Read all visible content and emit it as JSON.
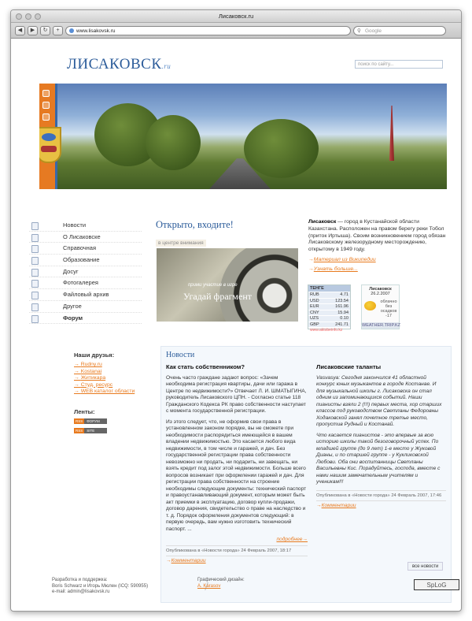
{
  "window": {
    "title": "Лисаковск.ru",
    "url": "www.lisakovsk.ru",
    "google": "Google"
  },
  "site": {
    "logo": "ЛИСАКОВСК",
    "logo_suffix": ".ru",
    "search_placeholder": "поиск по сайту..."
  },
  "nav": [
    "Новости",
    "О Лисаковске",
    "Справочная",
    "Образование",
    "Досуг",
    "Фотогалерея",
    "Файловый архив",
    "Другое",
    "Форум"
  ],
  "hero": {
    "title": "Открыто, входите!",
    "attention": "в центре внимания",
    "promo_small": "прими участие в игре",
    "promo_big": "Угадай фрагмент"
  },
  "about": {
    "city": "Лисаковск",
    "text": " — город в Кустанайской области Казахстана. Расположен на правом берегу реки Тобол (приток Иртыша). Своим возникновением город обязан Лисаковскому железорудному месторождению, открытому в 1949 году.",
    "wiki": "Материал из Википедии",
    "more": "Узнать больше..."
  },
  "informer": {
    "head": "ТЕНГЕ",
    "rows": [
      [
        "RUB",
        "4.71"
      ],
      [
        "USD",
        "123.54"
      ],
      [
        "EUR",
        "161.96"
      ],
      [
        "CNY",
        "15.94"
      ],
      [
        "UZS",
        "0.10"
      ],
      [
        "GBP",
        "241.71"
      ]
    ],
    "footer": "www.aktobeinfo.kz"
  },
  "weather": {
    "city": "Лисаковск",
    "date": "26.2.2007",
    "desc": "облачно без осадков -17",
    "footer": "WEATHER.TRIP.KZ"
  },
  "friends": {
    "title": "Наши друзья:",
    "items": [
      "Rudny.ru",
      "Kostanai",
      "Житикара",
      "Студ. ресурс",
      "WEB каталог области"
    ]
  },
  "lenty": {
    "title": "Ленты:",
    "items": [
      {
        "tag": "RSS",
        "name": "ФОРУМ"
      },
      {
        "tag": "RSS",
        "name": "SITE"
      }
    ]
  },
  "news": {
    "title": "Новости",
    "left": {
      "heading": "Как стать собственником?",
      "p1": "Очень часто граждане задают вопрос: «Зачем необходима регистрация квартиры, дачи или гаража в Центре по недвижимости?» Отвечает Л. И. ШМАТЫГИНА, руководитель Лисаковского ЦПН. - Согласно статье 118 Гражданского Кодекса РК право собственности наступает с момента государственной регистрации.",
      "p2": "Из этого следует, что, не оформив свои права в установленном законом порядке, вы не сможете при необходимости распорядиться имеющейся в вашем владении недвижимостью. Это касается любого вида недвижимости, в том числе и гаражей, и дач. Без государственной регистрации права собственности невозможно ни продать, ни подарить, ни завещать, ни взять кредит под залог этой недвижимости. Больше всего вопросов возникает при оформлении гаражей и дач. Для регистрации права собственности на строение необходимы следующие документы: технический паспорт и правоустанавливающий документ, которым может быть акт приемки в эксплуатацию, договор купли-продажи, договор дарения, свидетельство о праве на наследство и т. д. Порядок оформления документов следующий: в первую очередь, вам нужно изготовить технический паспорт. ...",
      "more": "подробнее→",
      "meta": "Опубликована в «Новости города» 24 Февраль 2007, 18:17",
      "comments": "Комментарии"
    },
    "right": {
      "heading": "Лисаковские таланты",
      "p1": "Vasvasya: Сегодня закончился 41 областной конкурс юных музыкантов в городе Костанае. И для музыкальной школы г. Лисаковска он стал одним из запоминающихся событий. Наши пианисты взяли 2 (!!!) первых места, хор старших классов под руководством Светланы Федоровны Ходаковской занял почетное третье место, пропустив Рудный и Костанай.",
      "p2": "Что касается пианистов - это впервые за всю историю школы такой безоговорочный успех. По младшей группе (до 9 лет) 1-е место у Жуковой Дианы, и по старшей группе - у Кукликовской Любови. Оба они воспитанницы Светланы Васильевны Кис. Порадуйтесь, господа, вместе с нами нашим замечательным учителям и ученикам!!!",
      "meta": "Опубликована в «Новости города» 24 Февраль 2007, 17:46",
      "comments": "Комментарии"
    },
    "all": "все новости"
  },
  "footer": {
    "line1": "Разработка и поддержка:",
    "line2": "Boris Schwarz и Игорь Мюлен (ICQ: 590955)",
    "line3": "e-mail: admin@lisakovsk.ru",
    "design": "Графический дизайн:",
    "designer": "A. Karasov",
    "badge": "SpLoG"
  }
}
